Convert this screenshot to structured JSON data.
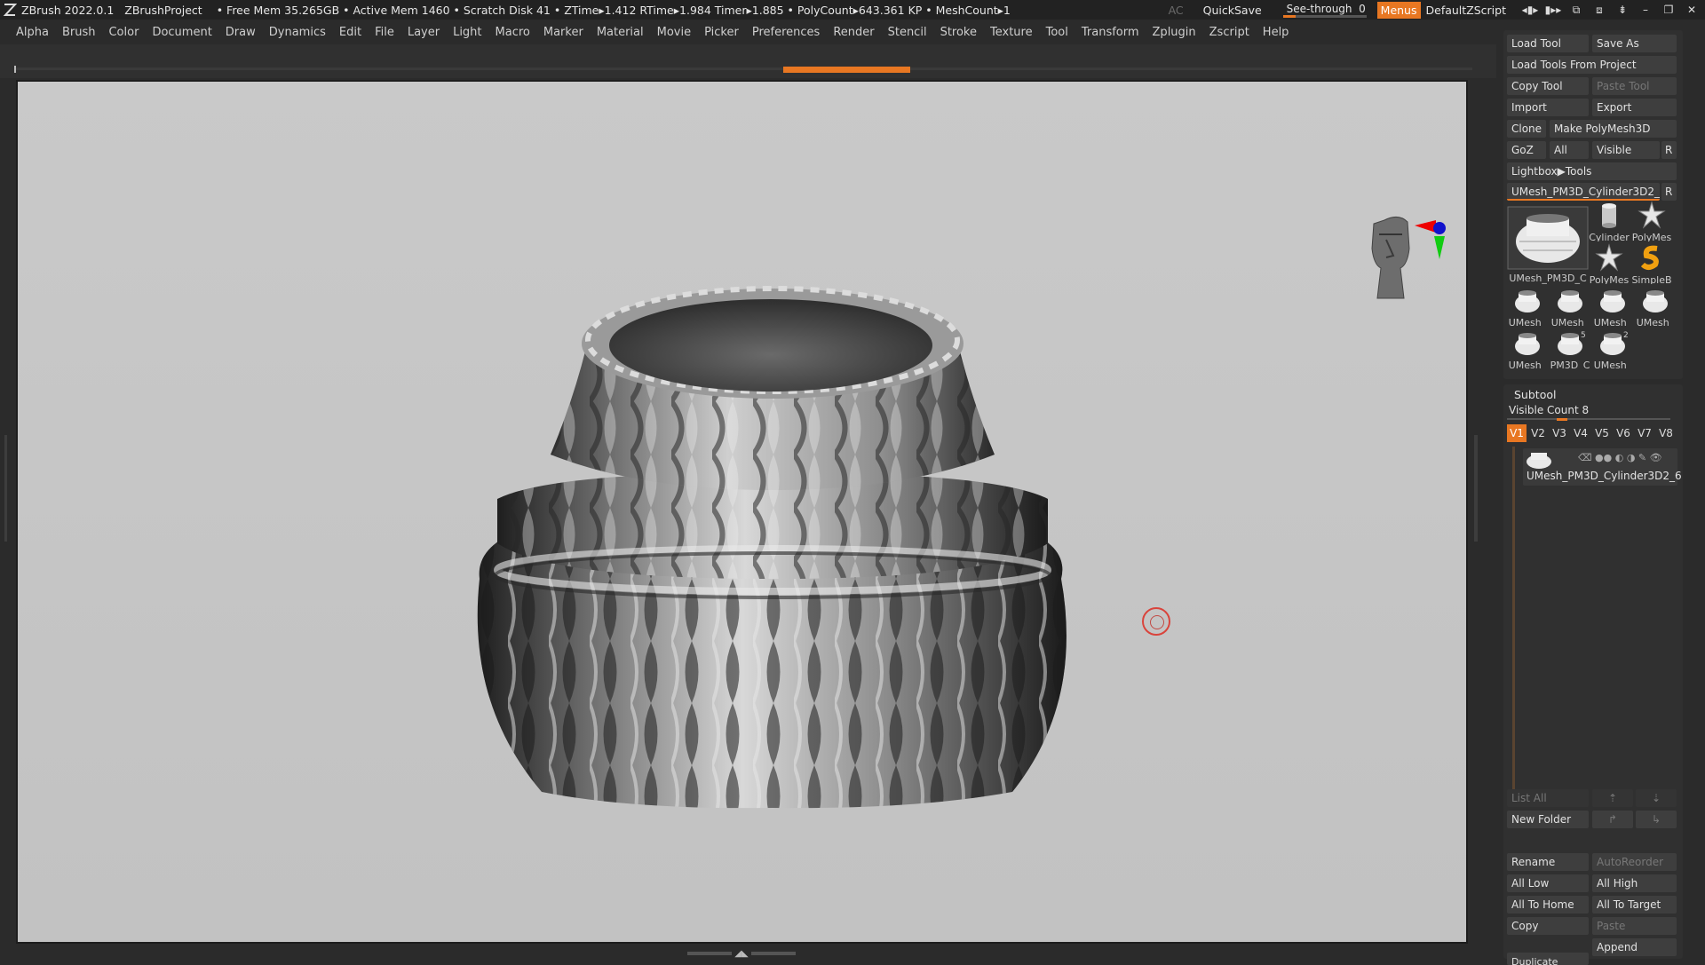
{
  "app": {
    "version": "ZBrush 2022.0.1",
    "project": "ZBrushProject",
    "stats": "• Free Mem 35.265GB • Active Mem 1460 • Scratch Disk 41 • ZTime▸1.412 RTime▸1.984 Timer▸1.885 • PolyCount▸643.361 KP • MeshCount▸1",
    "ac": "AC",
    "quicksave": "QuickSave",
    "see_through_label": "See-through",
    "see_through_value": "0",
    "see_through_level": 0.0,
    "menus_button": "Menus",
    "default_script": "DefaultZScript"
  },
  "menubar": [
    "Alpha",
    "Brush",
    "Color",
    "Document",
    "Draw",
    "Dynamics",
    "Edit",
    "File",
    "Layer",
    "Light",
    "Macro",
    "Marker",
    "Material",
    "Movie",
    "Picker",
    "Preferences",
    "Render",
    "Stencil",
    "Stroke",
    "Texture",
    "Tool",
    "Transform",
    "Zplugin",
    "Zscript",
    "Help"
  ],
  "tool_panel": {
    "load_tool": "Load Tool",
    "save_as": "Save As",
    "load_tools_from_project": "Load Tools From Project",
    "copy_tool": "Copy Tool",
    "paste_tool": "Paste Tool",
    "import": "Import",
    "export": "Export",
    "clone": "Clone",
    "make_polymesh": "Make PolyMesh3D",
    "goz": "GoZ",
    "all": "All",
    "visible": "Visible",
    "r": "R",
    "lightbox_tools": "Lightbox▶Tools",
    "current_tool": "UMesh_PM3D_Cylinder3D2_6",
    "current_thumb_label": "UMesh_PM3D_C",
    "thumbs": [
      {
        "label": "Cylinder",
        "icon": "cylinder-icon"
      },
      {
        "label": "PolyMes",
        "icon": "polymesh-star-icon"
      },
      {
        "label": "PolyMes",
        "icon": "polymesh-star-icon"
      },
      {
        "label": "SimpleB",
        "icon": "simplebrush-icon"
      },
      {
        "label": "UMesh_",
        "icon": "umesh-icon"
      },
      {
        "label": "UMesh_",
        "icon": "umesh-icon"
      },
      {
        "label": "UMesh_",
        "icon": "umesh-icon"
      },
      {
        "label": "UMesh_",
        "icon": "umesh-icon"
      },
      {
        "label": "UMesh_",
        "icon": "umesh-icon"
      },
      {
        "label": "PM3D_C",
        "icon": "umesh-icon",
        "badge": "5"
      },
      {
        "label": "UMesh_",
        "icon": "umesh-icon",
        "badge": "2"
      }
    ]
  },
  "subtool": {
    "title": "Subtool",
    "visible_count": "Visible Count 8",
    "visible_count_level": 0.125,
    "versions": [
      "V1",
      "V2",
      "V3",
      "V4",
      "V5",
      "V6",
      "V7",
      "V8"
    ],
    "active_version": "V1",
    "item_name": "UMesh_PM3D_Cylinder3D2_6",
    "list_all": "List All",
    "new_folder": "New Folder",
    "rename": "Rename",
    "auto_reorder": "AutoReorder",
    "all_low": "All Low",
    "all_high": "All High",
    "all_to_home": "All To Home",
    "all_to_target": "All To Target",
    "copy": "Copy",
    "paste": "Paste",
    "append": "Append",
    "duplicate": "Duplicate"
  },
  "colors": {
    "accent": "#e87722",
    "panel": "#303030",
    "button": "#3e3e3e",
    "canvas": "#c6c6c6"
  }
}
